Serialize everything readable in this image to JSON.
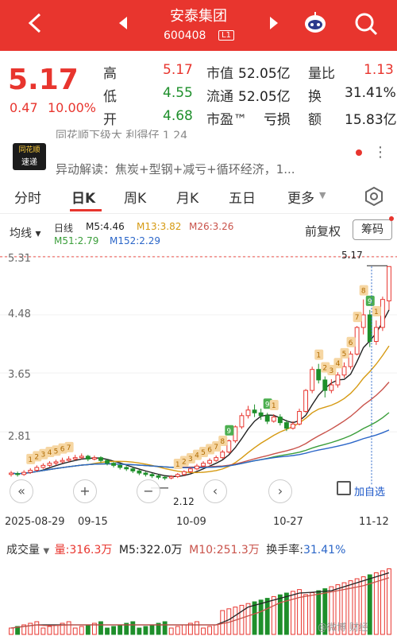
{
  "header": {
    "stock_name": "安泰集团",
    "stock_code": "600408",
    "level": "L1",
    "colors": {
      "bg": "#e8352e"
    }
  },
  "quote": {
    "price": "5.17",
    "change": "0.47",
    "change_pct": "10.00%",
    "high_label": "高",
    "high": "5.17",
    "low_label": "低",
    "low": "4.55",
    "open_label": "开",
    "open": "4.68",
    "mktcap_label": "市值",
    "mktcap": "52.05亿",
    "float_label": "流通",
    "float": "52.05亿",
    "pe_label": "市盈™",
    "pe": "亏损",
    "vol_ratio_label": "量比",
    "vol_ratio": "1.13",
    "turnover_label": "换",
    "turnover": "31.41%",
    "amount_label": "额",
    "amount": "15.83亿"
  },
  "news": {
    "line1": "同花顺下级大 利得仔 1 24",
    "logo_top": "同花顺",
    "logo_bottom": "速递",
    "line2": "异动解读：焦炭+型钢+减亏+循环经济，1...",
    "more_icon": "⋮"
  },
  "tabs": {
    "items": [
      "分时",
      "日K",
      "周K",
      "月K",
      "五日",
      "更多"
    ],
    "more_arrow": "▼"
  },
  "indicators": {
    "ma_select": "均线 ▾",
    "line_type": "日线",
    "m5": "M5:4.46",
    "m13": "M13:3.82",
    "m26": "M26:3.26",
    "m51": "M51:2.79",
    "m152": "M152:2.29",
    "adjust": "前复权",
    "chip_button": "筹码"
  },
  "chart": {
    "y_ticks": [
      "5.31",
      "4.48",
      "3.65",
      "2.81"
    ],
    "x_ticks": [
      "2025-08-29",
      "09-15",
      "10-09",
      "10-27",
      "11-12"
    ],
    "max_tag": "5.17",
    "min_tag": "2.12",
    "add_self": "加自选"
  },
  "chart_data": {
    "type": "candlestick",
    "y_axis_ticks": [
      5.31,
      4.48,
      3.65,
      2.81
    ],
    "max_marker": 5.17,
    "min_marker": 2.12,
    "x_ticks": [
      "2025-08-29",
      "09-15",
      "10-09",
      "10-27",
      "11-12"
    ],
    "candles": [
      {
        "o": 2.2,
        "c": 2.22,
        "h": 2.25,
        "l": 2.17
      },
      {
        "o": 2.21,
        "c": 2.2,
        "h": 2.24,
        "l": 2.17
      },
      {
        "o": 2.2,
        "c": 2.23,
        "h": 2.26,
        "l": 2.18
      },
      {
        "o": 2.23,
        "c": 2.26,
        "h": 2.29,
        "l": 2.21
      },
      {
        "o": 2.26,
        "c": 2.3,
        "h": 2.33,
        "l": 2.24
      },
      {
        "o": 2.3,
        "c": 2.33,
        "h": 2.36,
        "l": 2.28
      },
      {
        "o": 2.33,
        "c": 2.36,
        "h": 2.39,
        "l": 2.31
      },
      {
        "o": 2.36,
        "c": 2.38,
        "h": 2.41,
        "l": 2.33
      },
      {
        "o": 2.38,
        "c": 2.4,
        "h": 2.44,
        "l": 2.36
      },
      {
        "o": 2.4,
        "c": 2.42,
        "h": 2.46,
        "l": 2.38
      },
      {
        "o": 2.42,
        "c": 2.44,
        "h": 2.48,
        "l": 2.4
      },
      {
        "o": 2.44,
        "c": 2.46,
        "h": 2.5,
        "l": 2.42
      },
      {
        "o": 2.46,
        "c": 2.42,
        "h": 2.48,
        "l": 2.39
      },
      {
        "o": 2.42,
        "c": 2.44,
        "h": 2.47,
        "l": 2.4
      },
      {
        "o": 2.44,
        "c": 2.4,
        "h": 2.46,
        "l": 2.37
      },
      {
        "o": 2.4,
        "c": 2.36,
        "h": 2.42,
        "l": 2.33
      },
      {
        "o": 2.36,
        "c": 2.33,
        "h": 2.38,
        "l": 2.3
      },
      {
        "o": 2.33,
        "c": 2.3,
        "h": 2.35,
        "l": 2.27
      },
      {
        "o": 2.3,
        "c": 2.28,
        "h": 2.32,
        "l": 2.25
      },
      {
        "o": 2.28,
        "c": 2.25,
        "h": 2.3,
        "l": 2.22
      },
      {
        "o": 2.25,
        "c": 2.22,
        "h": 2.27,
        "l": 2.19
      },
      {
        "o": 2.22,
        "c": 2.2,
        "h": 2.24,
        "l": 2.17
      },
      {
        "o": 2.2,
        "c": 2.18,
        "h": 2.22,
        "l": 2.15
      },
      {
        "o": 2.18,
        "c": 2.16,
        "h": 2.2,
        "l": 2.13
      },
      {
        "o": 2.16,
        "c": 2.15,
        "h": 2.18,
        "l": 2.12
      },
      {
        "o": 2.15,
        "c": 2.17,
        "h": 2.19,
        "l": 2.13
      },
      {
        "o": 2.17,
        "c": 2.2,
        "h": 2.22,
        "l": 2.15
      },
      {
        "o": 2.2,
        "c": 2.24,
        "h": 2.26,
        "l": 2.18
      },
      {
        "o": 2.24,
        "c": 2.28,
        "h": 2.3,
        "l": 2.22
      },
      {
        "o": 2.28,
        "c": 2.32,
        "h": 2.35,
        "l": 2.26
      },
      {
        "o": 2.32,
        "c": 2.36,
        "h": 2.39,
        "l": 2.3
      },
      {
        "o": 2.36,
        "c": 2.4,
        "h": 2.43,
        "l": 2.34
      },
      {
        "o": 2.4,
        "c": 2.44,
        "h": 2.47,
        "l": 2.38
      },
      {
        "o": 2.44,
        "c": 2.52,
        "h": 2.55,
        "l": 2.42
      },
      {
        "o": 2.52,
        "c": 2.68,
        "h": 2.7,
        "l": 2.5
      },
      {
        "o": 2.68,
        "c": 2.88,
        "h": 2.9,
        "l": 2.65
      },
      {
        "o": 2.88,
        "c": 3.04,
        "h": 3.08,
        "l": 2.85
      },
      {
        "o": 3.04,
        "c": 3.12,
        "h": 3.18,
        "l": 3.0
      },
      {
        "o": 3.12,
        "c": 3.08,
        "h": 3.2,
        "l": 3.02
      },
      {
        "o": 3.08,
        "c": 3.04,
        "h": 3.14,
        "l": 2.98
      },
      {
        "o": 3.04,
        "c": 2.96,
        "h": 3.08,
        "l": 2.92
      },
      {
        "o": 2.96,
        "c": 3.02,
        "h": 3.06,
        "l": 2.94
      },
      {
        "o": 3.02,
        "c": 2.94,
        "h": 3.06,
        "l": 2.9
      },
      {
        "o": 2.94,
        "c": 2.86,
        "h": 2.98,
        "l": 2.82
      },
      {
        "o": 2.86,
        "c": 2.92,
        "h": 2.96,
        "l": 2.84
      },
      {
        "o": 2.92,
        "c": 3.1,
        "h": 3.14,
        "l": 2.9
      },
      {
        "o": 3.1,
        "c": 3.4,
        "h": 3.42,
        "l": 3.08
      },
      {
        "o": 3.4,
        "c": 3.7,
        "h": 3.74,
        "l": 3.36
      },
      {
        "o": 3.7,
        "c": 3.55,
        "h": 3.78,
        "l": 3.5
      },
      {
        "o": 3.55,
        "c": 3.4,
        "h": 3.6,
        "l": 3.3
      },
      {
        "o": 3.4,
        "c": 3.48,
        "h": 3.56,
        "l": 3.36
      },
      {
        "o": 3.48,
        "c": 3.62,
        "h": 3.66,
        "l": 3.44
      },
      {
        "o": 3.62,
        "c": 3.74,
        "h": 3.8,
        "l": 3.58
      },
      {
        "o": 3.74,
        "c": 3.92,
        "h": 3.96,
        "l": 3.7
      },
      {
        "o": 3.92,
        "c": 4.3,
        "h": 4.32,
        "l": 3.9
      },
      {
        "o": 4.3,
        "c": 4.48,
        "h": 4.7,
        "l": 4.2
      },
      {
        "o": 4.48,
        "c": 4.1,
        "h": 4.55,
        "l": 4.02
      },
      {
        "o": 4.1,
        "c": 4.3,
        "h": 4.4,
        "l": 4.05
      },
      {
        "o": 4.3,
        "c": 4.7,
        "h": 4.74,
        "l": 4.25
      },
      {
        "o": 4.68,
        "c": 5.17,
        "h": 5.17,
        "l": 4.55
      }
    ],
    "ma": {
      "M5": 4.46,
      "M13": 3.82,
      "M26": 3.26,
      "M51": 2.79,
      "M152": 2.29
    },
    "volume": {
      "latest": "316.3万",
      "M5": "322.0万",
      "M10": "251.3万",
      "turnover_rate": "31.41%"
    }
  },
  "volume_bar": {
    "title": "成交量",
    "vol_label": "量:316.3万",
    "m5_label": "M5:322.0万",
    "m10_label": "M10:251.3万",
    "turnover_label": "换手率:",
    "turnover_value": "31.41%"
  },
  "watermark": "@微博 财经"
}
